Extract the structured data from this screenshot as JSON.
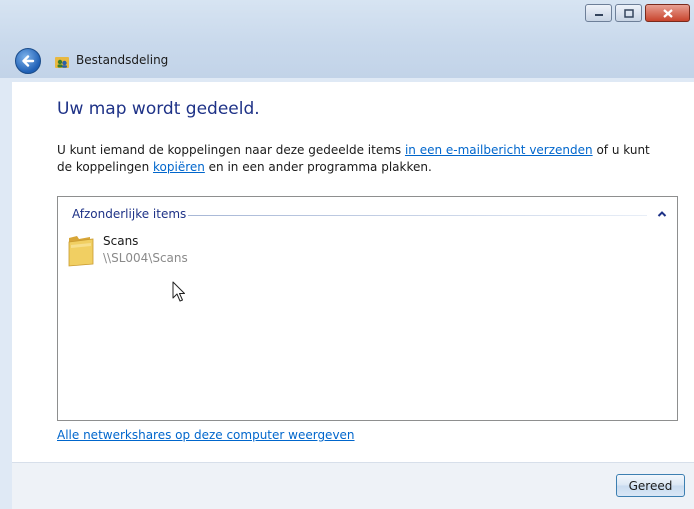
{
  "window": {
    "title": "Bestandsdeling",
    "controls": {
      "minimize": "minimize-icon",
      "maximize": "maximize-icon",
      "close": "close-icon"
    }
  },
  "main": {
    "heading": "Uw map wordt gedeeld.",
    "description": {
      "part1": "U kunt iemand de koppelingen naar deze gedeelde items ",
      "link_email": "in een e-mailbericht verzenden",
      "part2": " of u kunt de koppelingen ",
      "link_copy": "kopiëren",
      "part3": " en in een ander programma plakken."
    },
    "group": {
      "header": "Afzonderlijke items",
      "items": [
        {
          "name": "Scans",
          "path": "\\\\SL004\\Scans",
          "icon": "folder-icon"
        }
      ]
    },
    "all_shares_link": "Alle netwerkshares op deze computer weergeven"
  },
  "footer": {
    "done_label": "Gereed"
  },
  "colors": {
    "heading": "#1e3287",
    "link": "#0066cc",
    "titlebar": "#c9d9ec"
  }
}
